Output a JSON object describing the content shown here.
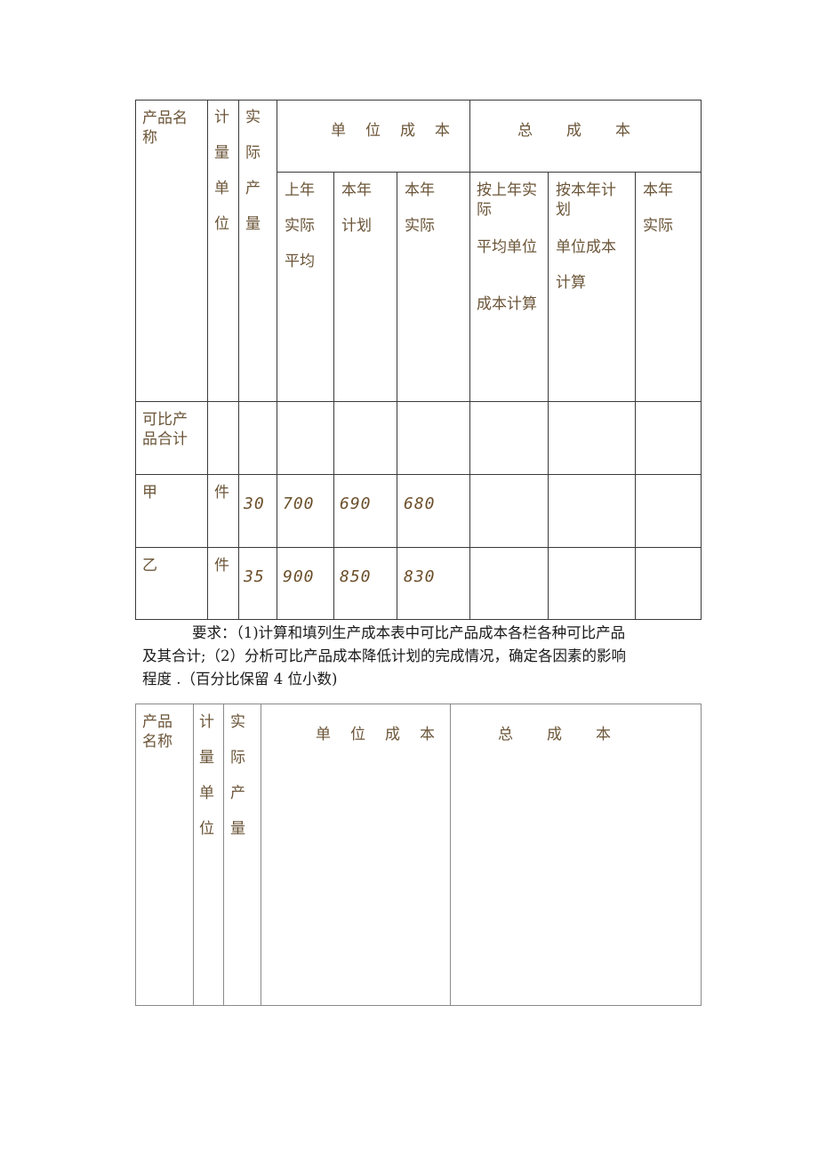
{
  "table1": {
    "headers": {
      "product_name": "产品名称",
      "unit_lines": [
        "计",
        "量",
        "单",
        "位"
      ],
      "output_lines": [
        "实",
        "际",
        "产",
        "量"
      ],
      "unit_cost": "单位成本",
      "total_cost": "总成本",
      "unit_cost_sub": [
        {
          "lines": [
            "上年",
            "实际",
            "平均"
          ]
        },
        {
          "lines": [
            "本年",
            "计划"
          ]
        },
        {
          "lines": [
            "本年",
            "实际"
          ]
        }
      ],
      "total_cost_sub": [
        {
          "lines": [
            "按上年实际",
            "平均单位",
            "成本计算"
          ]
        },
        {
          "lines": [
            "按本年计划",
            "单位成本",
            "计算"
          ]
        },
        {
          "lines": [
            "本年",
            "实际"
          ]
        }
      ]
    },
    "rows": [
      {
        "name": "可比产品合计",
        "unit": "",
        "output": "",
        "last_year_avg": "",
        "plan": "",
        "actual": "",
        "total_last": "",
        "total_plan": "",
        "total_actual": ""
      },
      {
        "name": "甲",
        "unit": "件",
        "output": "30",
        "last_year_avg": "700",
        "plan": "690",
        "actual": "680",
        "total_last": "",
        "total_plan": "",
        "total_actual": ""
      },
      {
        "name": "乙",
        "unit": "件",
        "output": "35",
        "last_year_avg": "900",
        "plan": "850",
        "actual": "830",
        "total_last": "",
        "total_plan": "",
        "total_actual": ""
      }
    ]
  },
  "requirement": {
    "line1": "要求：（1)计算和填列生产成本表中可比产品成本各栏各种可比产品",
    "line2": "及其合计;（2）分析可比产品成本降低计划的完成情况，确定各因素的影响",
    "line3": "程度 .（百分比保留 4 位小数)"
  },
  "table2": {
    "headers": {
      "product_name_lines": [
        "产品",
        "名称"
      ],
      "unit_lines": [
        "计",
        "量",
        "单",
        "位"
      ],
      "output_lines": [
        "实",
        "际",
        "产",
        "量"
      ],
      "unit_cost": "单位成本",
      "total_cost": "总成本"
    }
  }
}
